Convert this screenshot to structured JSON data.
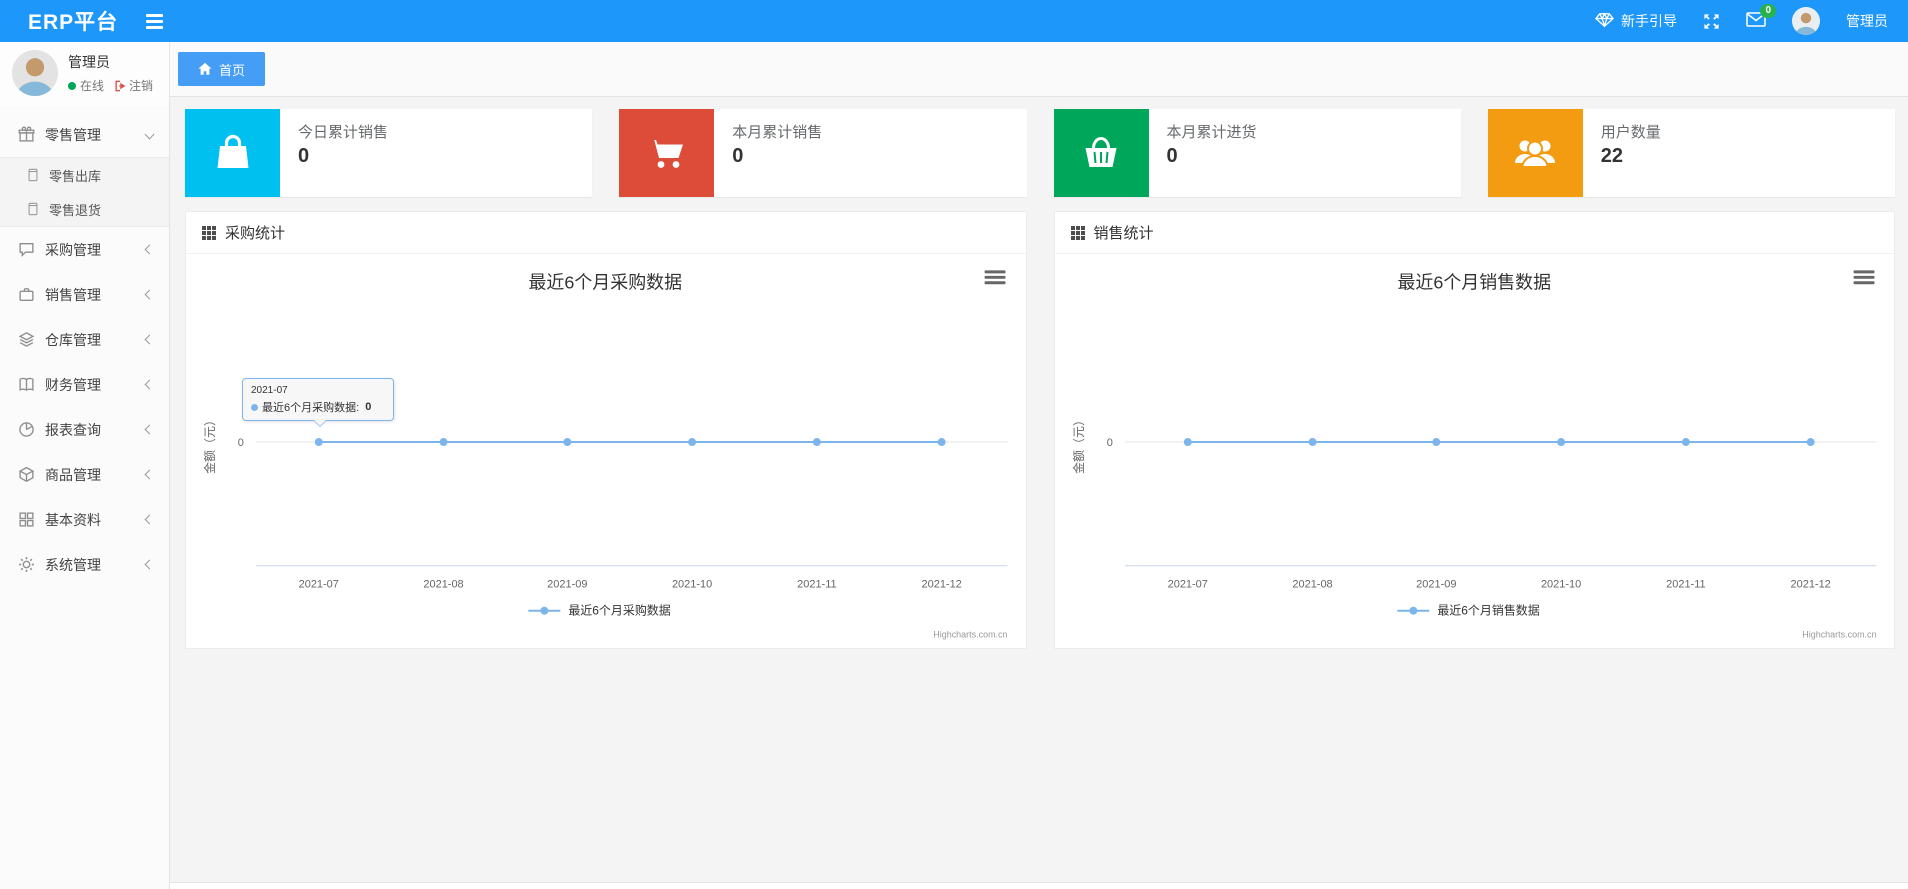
{
  "navbar": {
    "brand": "ERP平台",
    "guide_label": "新手引导",
    "mail_badge": "0",
    "username": "管理员"
  },
  "sidebar": {
    "user": {
      "name": "管理员",
      "status": "在线",
      "logout": "注销"
    },
    "items": [
      {
        "label": "零售管理",
        "expanded": true
      },
      {
        "label": "零售出库"
      },
      {
        "label": "零售退货"
      },
      {
        "label": "采购管理",
        "expanded": false
      },
      {
        "label": "销售管理",
        "expanded": false
      },
      {
        "label": "仓库管理",
        "expanded": false
      },
      {
        "label": "财务管理",
        "expanded": false
      },
      {
        "label": "报表查询",
        "expanded": false
      },
      {
        "label": "商品管理",
        "expanded": false
      },
      {
        "label": "基本资料",
        "expanded": false
      },
      {
        "label": "系统管理",
        "expanded": false
      }
    ]
  },
  "tabs": {
    "home": "首页"
  },
  "cards": [
    {
      "label": "今日累计销售",
      "value": "0",
      "color": "#00c0ef",
      "icon": "shopping-bag-icon"
    },
    {
      "label": "本月累计销售",
      "value": "0",
      "color": "#dd4b39",
      "icon": "shopping-cart-icon"
    },
    {
      "label": "本月累计进货",
      "value": "0",
      "color": "#00a65a",
      "icon": "shopping-basket-icon"
    },
    {
      "label": "用户数量",
      "value": "22",
      "color": "#f39c12",
      "icon": "users-icon"
    }
  ],
  "panels": [
    {
      "title": "采购统计"
    },
    {
      "title": "销售统计"
    }
  ],
  "chart_data": [
    {
      "type": "line",
      "title": "最近6个月采购数据",
      "categories": [
        "2021-07",
        "2021-08",
        "2021-09",
        "2021-10",
        "2021-11",
        "2021-12"
      ],
      "series": [
        {
          "name": "最近6个月采购数据",
          "values": [
            0,
            0,
            0,
            0,
            0,
            0
          ]
        }
      ],
      "ylabel": "金额（元）",
      "ytick_labels": [
        "0"
      ],
      "ylim": [
        0,
        0
      ],
      "grid": true,
      "legend_position": "bottom"
    },
    {
      "type": "line",
      "title": "最近6个月销售数据",
      "categories": [
        "2021-07",
        "2021-08",
        "2021-09",
        "2021-10",
        "2021-11",
        "2021-12"
      ],
      "series": [
        {
          "name": "最近6个月销售数据",
          "values": [
            0,
            0,
            0,
            0,
            0,
            0
          ]
        }
      ],
      "ylabel": "金额（元）",
      "ytick_labels": [
        "0"
      ],
      "ylim": [
        0,
        0
      ],
      "grid": true,
      "legend_position": "bottom"
    }
  ],
  "tooltip": {
    "header": "2021-07",
    "label": "最近6个月采购数据:",
    "value": "0"
  },
  "credits": "Highcharts.com.cn",
  "colors": {
    "navbar_bg": "#1e97fa",
    "tab_active_bg": "#459df5",
    "series_line": "#7cb5ec",
    "badge_bg": "#28b14c",
    "online_dot": "#00a65a",
    "logout_icon": "#d9534f"
  }
}
